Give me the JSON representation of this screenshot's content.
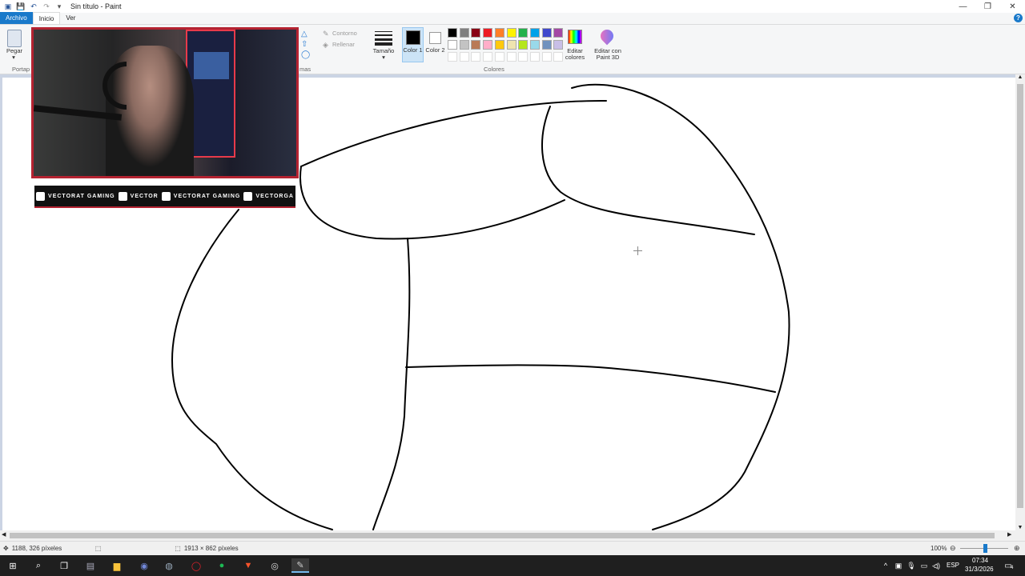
{
  "window": {
    "title": "Sin título - Paint"
  },
  "menu": {
    "file": "Archivo",
    "home": "Inicio",
    "view": "Ver"
  },
  "ribbon": {
    "paste_label": "Pegar",
    "clipboard_group": "Portap",
    "shapes_group": "mas",
    "outline_label": "Contorno",
    "fill_label": "Rellenar",
    "size_label": "Tamaño",
    "color1_label": "Color 1",
    "color2_label": "Color 2",
    "colors_group": "Colores",
    "edit_colors_label": "Editar colores",
    "edit_paint3d_label": "Editar con Paint 3D",
    "palette_row1": [
      "#000000",
      "#7f7f7f",
      "#880015",
      "#ed1c24",
      "#ff7f27",
      "#fff200",
      "#22b14c",
      "#00a2e8",
      "#3f48cc",
      "#a349a4"
    ],
    "palette_row2": [
      "#ffffff",
      "#c3c3c3",
      "#b97a57",
      "#ffaec9",
      "#ffc90e",
      "#efe4b0",
      "#b5e61d",
      "#99d9ea",
      "#7092be",
      "#c8bfe7"
    ]
  },
  "overlay": {
    "social": [
      {
        "icon": "youtube-icon",
        "text": "VECTORAT GAMING"
      },
      {
        "icon": "twitch-icon",
        "text": "VECTOR"
      },
      {
        "icon": "twitter-icon",
        "text": "VECTORAT GAMING"
      },
      {
        "icon": "instagram-icon",
        "text": "VECTORGA"
      }
    ]
  },
  "status": {
    "cursor_pos": "1188, 326 píxeles",
    "canvas_size": "1913 × 862 píxeles",
    "zoom": "100%"
  },
  "taskbar": {
    "lang": "ESP",
    "time": "07:34",
    "date": "31/3/2026",
    "notif_count": "4"
  }
}
